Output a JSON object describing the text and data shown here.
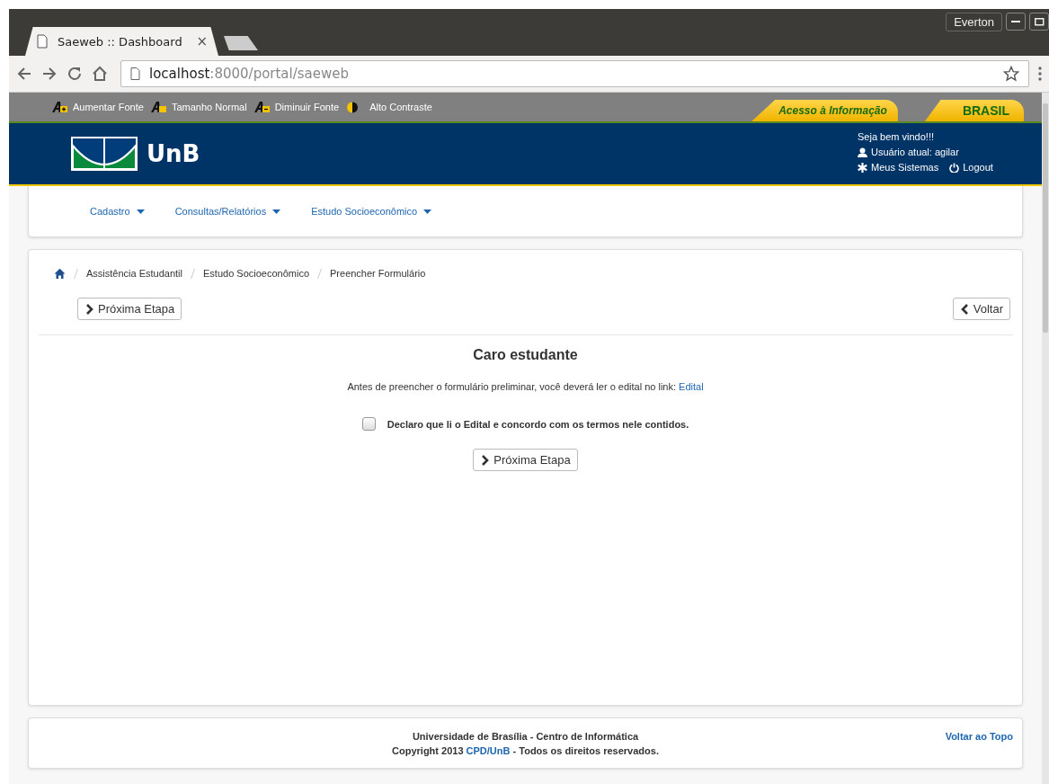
{
  "browser": {
    "tab": {
      "title": "Saeweb :: Dashboard",
      "close": "×",
      "selected": true
    },
    "profile": "Everton",
    "address": {
      "host": "localhost",
      "path": ":8000/portal/saeweb"
    }
  },
  "accessibility_bar": [
    {
      "kind": "increase",
      "label": "Aumentar Fonte"
    },
    {
      "kind": "normal",
      "label": "Tamanho Normal"
    },
    {
      "kind": "decrease",
      "label": "Diminuir Fonte"
    },
    {
      "kind": "contrast",
      "label": "Alto Contraste"
    }
  ],
  "gov_links": [
    "Acesso à Informação",
    "BRASIL"
  ],
  "header": {
    "logo_text": "UnB",
    "welcome": "Seja bem vindo!!!",
    "user": "Usuário atual: agilar",
    "systems": "Meus Sistemas",
    "logout": "Logout"
  },
  "menu": [
    "Cadastro",
    "Consultas/Relatórios",
    "Estudo Socioeconômico"
  ],
  "breadcrumb": [
    "Assistência Estudantil",
    "Estudo Socioeconômico",
    "Preencher Formulário"
  ],
  "toolbar": {
    "next": "Próxima Etapa",
    "back": "Voltar"
  },
  "content": {
    "title": "Caro estudante",
    "intro": "Antes de preencher o formulário preliminar, você deverá ler o edital no link:",
    "intro_link": "Edital",
    "agreement": {
      "label": "Declaro que li o Edital e concordo com os termos nele contidos.",
      "checked": false
    },
    "next_button": "Próxima Etapa"
  },
  "footer": {
    "line1": "Universidade de Brasília - Centro de Informática",
    "line2_prefix": "Copyright 2013",
    "line2_link": "CPD/UnB",
    "line2_suffix": "- Todos os direitos reservados.",
    "top_link": "Voltar ao Topo"
  }
}
